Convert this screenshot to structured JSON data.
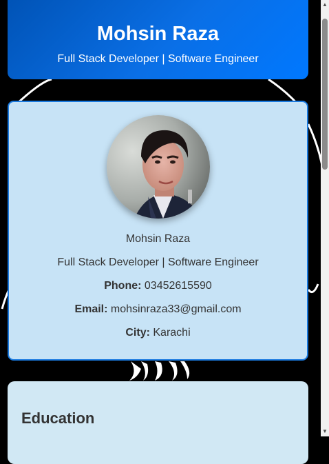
{
  "header": {
    "name": "Mohsin Raza",
    "tagline": "Full Stack Developer | Software Engineer"
  },
  "profile": {
    "name": "Mohsin Raza",
    "title": "Full Stack Developer | Software Engineer",
    "phone_label": "Phone:",
    "phone": "03452615590",
    "email_label": "Email:",
    "email": "mohsinraza33@gmail.com",
    "city_label": "City:",
    "city": "Karachi",
    "avatar_icon": "profile-photo"
  },
  "education": {
    "heading": "Education"
  },
  "colors": {
    "header_start": "#0052b4",
    "header_end": "#0078ff",
    "profile_bg": "#c7e3f6",
    "profile_border": "#1a7ae0",
    "education_bg": "#d1e8f4"
  },
  "scrollbar": {
    "up_icon": "scroll-up-arrow",
    "down_icon": "scroll-down-arrow"
  }
}
